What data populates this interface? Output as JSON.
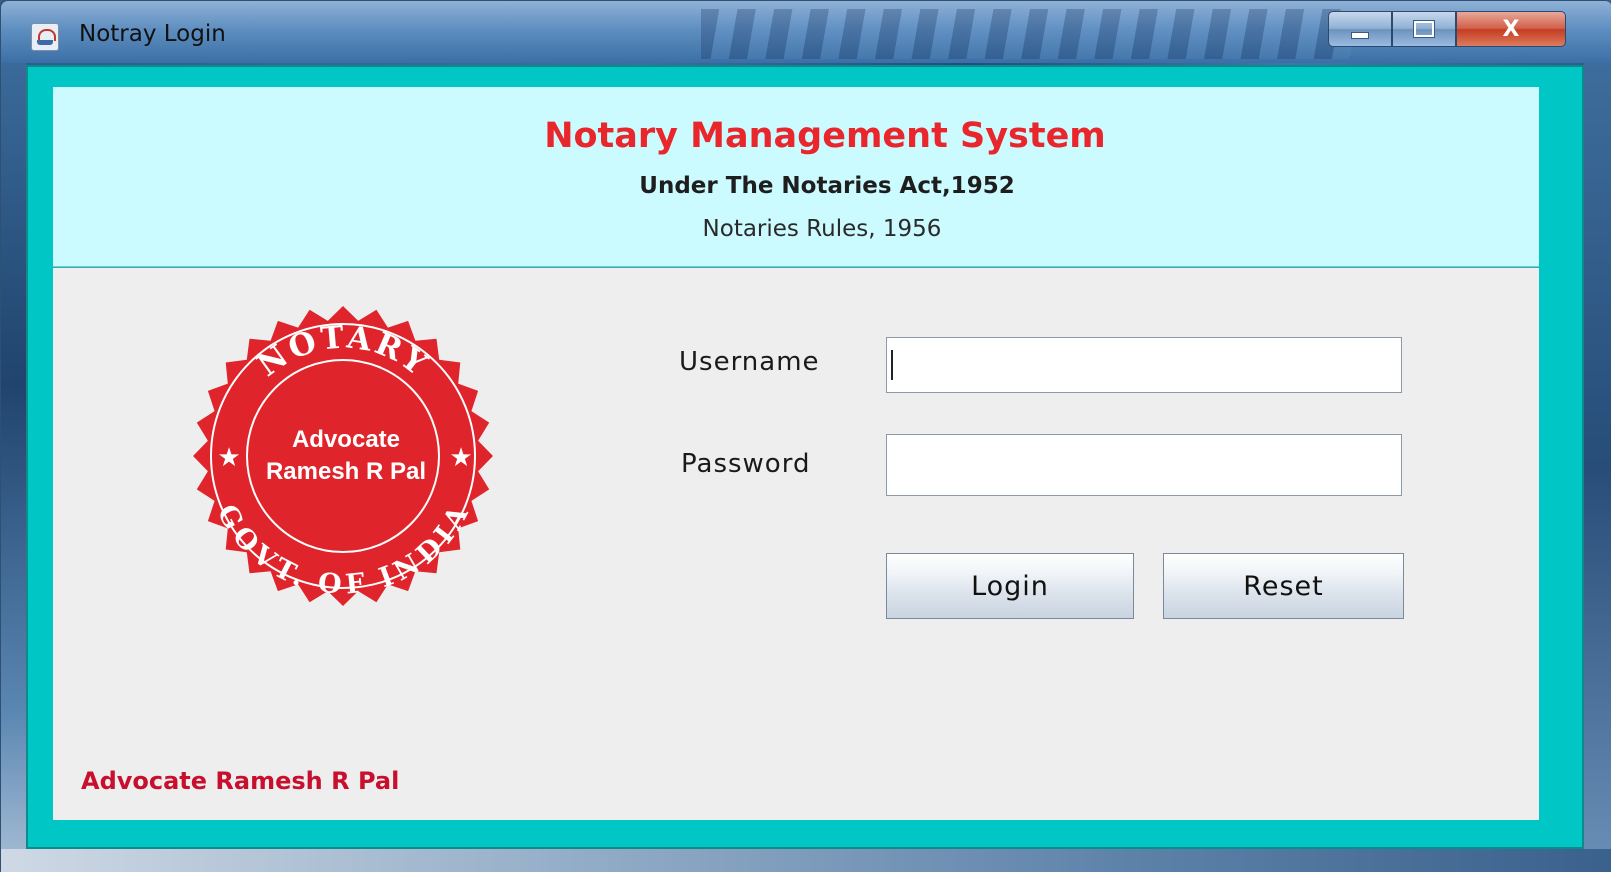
{
  "window": {
    "title": "Notray Login",
    "close_label": "X"
  },
  "header": {
    "title": "Notary Management System",
    "subtitle_act": "Under The Notaries Act,1952",
    "subtitle_rules": "Notaries Rules, 1956"
  },
  "seal": {
    "top_text": "NOTARY",
    "center_line1": "Advocate",
    "center_line2": "Ramesh R Pal",
    "bottom_text": "GOVT. OF INDIA",
    "color": "#e0242b"
  },
  "form": {
    "username_label": "Username",
    "username_value": "",
    "password_label": "Password",
    "password_value": "",
    "login_label": "Login",
    "reset_label": "Reset"
  },
  "footer": {
    "credit": "Advocate Ramesh R Pal"
  },
  "colors": {
    "title_red": "#e8262c",
    "header_bg": "#ccfbff",
    "frame_teal": "#00c6c6",
    "credit_red": "#c8102e"
  }
}
